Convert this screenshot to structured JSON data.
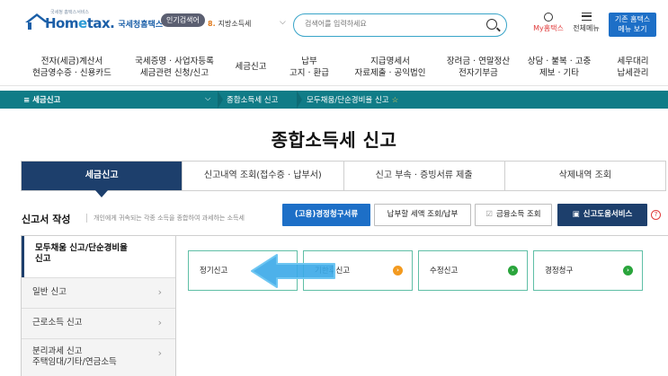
{
  "header": {
    "logo_tiny": "국세청 홈택스서비스",
    "logo_text_pre": "Hom",
    "logo_text_e": "e",
    "logo_text_post": "tax.",
    "logo_sub": "국세청홈택스",
    "hot_badge": "인기검색어",
    "hot_rank": "8.",
    "hot_term": "지방소득세",
    "search_placeholder": "검색어를 입력하세요",
    "my_home": "My홈택스",
    "all_menu": "전체메뉴",
    "classic_line1": "기존 홈택스",
    "classic_line2": "메뉴 보기"
  },
  "gnb": [
    {
      "l1": "전자(세금)계산서",
      "l2": "현금영수증 · 신용카드"
    },
    {
      "l1": "국세증명 · 사업자등록",
      "l2": "세금관련 신청/신고"
    },
    {
      "l1": "세금신고",
      "l2": ""
    },
    {
      "l1": "납부",
      "l2": "고지 · 환급"
    },
    {
      "l1": "지급명세서",
      "l2": "자료제출 · 공익법인"
    },
    {
      "l1": "장려금 · 연말정산",
      "l2": "전자기부금"
    },
    {
      "l1": "상담 · 불복 · 고충",
      "l2": "제보 · 기타"
    },
    {
      "l1": "세무대리",
      "l2": "납세관리"
    }
  ],
  "breadcrumb": {
    "menu": "≡  세금신고",
    "level2": "종합소득세 신고",
    "level3": "모두채움/단순경비율 신고"
  },
  "page_title": "종합소득세 신고",
  "tabs": [
    "세금신고",
    "신고내역 조회(접수증 · 납부서)",
    "신고 부속 · 증빙서류 제출",
    "삭제내역 조회"
  ],
  "section": {
    "title": "신고서 작성",
    "desc": "개인에게 귀속되는 각종 소득을 종합하여 과세하는 소득세",
    "btn_update": "(고용)경정청구서류",
    "btn_tax": "납부할 세액 조회/납부",
    "btn_finance": "금융소득 조회",
    "btn_service": "신고도움서비스"
  },
  "side_menu": [
    {
      "line1": "모두채움 신고/단순경비율",
      "line2": "신고"
    },
    {
      "line1": "일반 신고",
      "line2": ""
    },
    {
      "line1": "근로소득 신고",
      "line2": ""
    },
    {
      "line1": "분리과세 신고",
      "line2": "주택임대/기타/연금소득"
    }
  ],
  "cards": [
    "정기신고",
    "기한후신고",
    "수정신고",
    "경정청구"
  ],
  "colors": {
    "accent_teal": "#107c87",
    "navy": "#1d3f6c",
    "blue": "#1d6fc7",
    "card_border": "#5fbfa6"
  }
}
